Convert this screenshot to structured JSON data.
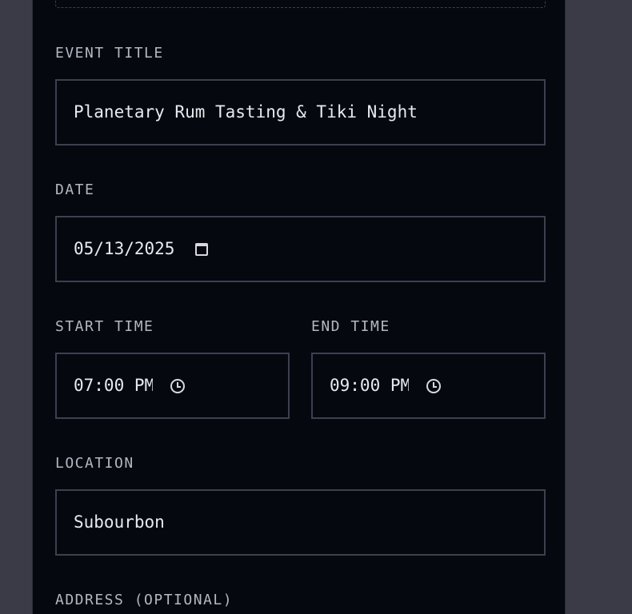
{
  "form": {
    "event_title": {
      "label": "EVENT TITLE",
      "value": "Planetary Rum Tasting & Tiki Night"
    },
    "date": {
      "label": "DATE",
      "value": "05/13/2025",
      "icon": "calendar-icon"
    },
    "start_time": {
      "label": "START TIME",
      "value": "07:00 PM",
      "icon": "clock-icon"
    },
    "end_time": {
      "label": "END TIME",
      "value": "09:00 PM",
      "icon": "clock-icon"
    },
    "location": {
      "label": "LOCATION",
      "value": "Subourbon"
    },
    "address": {
      "label": "ADDRESS (OPTIONAL)"
    }
  },
  "colors": {
    "page_background": "#3a3b47",
    "panel_background": "#06080f",
    "field_border": "#3c4150",
    "label_text": "#b3b7c2",
    "value_text": "#e8eaf0"
  }
}
